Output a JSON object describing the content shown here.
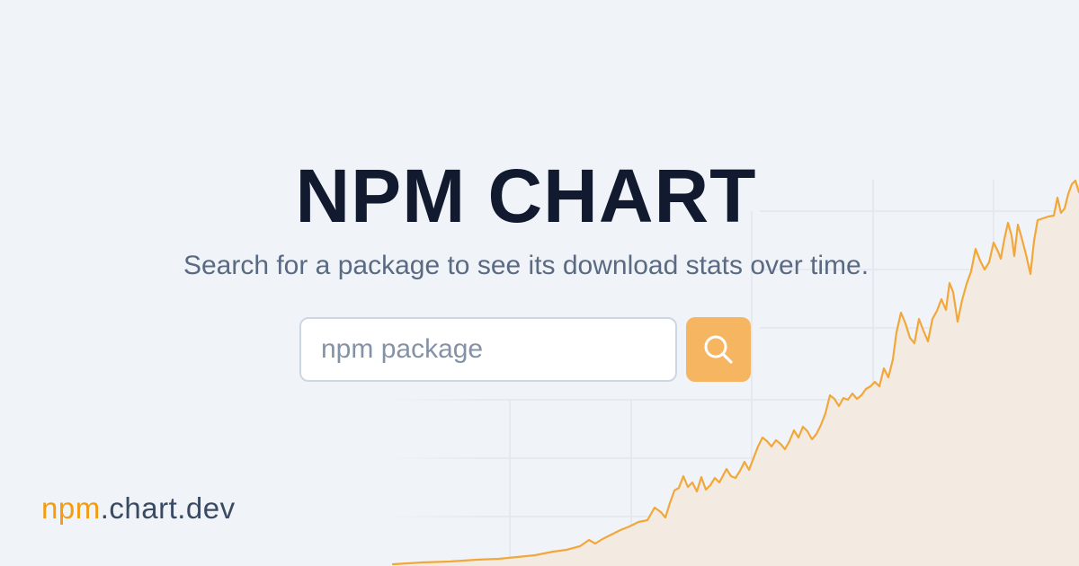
{
  "header": {
    "title": "NPM CHART",
    "subtitle": "Search for a package to see its download stats over time."
  },
  "search": {
    "placeholder": "npm package",
    "value": "",
    "button_icon": "search-icon"
  },
  "brand": {
    "accent": "npm",
    "rest": ".chart.dev"
  },
  "colors": {
    "background": "#f0f4f9",
    "title": "#111a2e",
    "subtitle": "#5a6a82",
    "accent": "#f39c12",
    "button": "#f6b561",
    "chart_line": "#f2a73b",
    "chart_fill": "#f3ebe2"
  }
}
